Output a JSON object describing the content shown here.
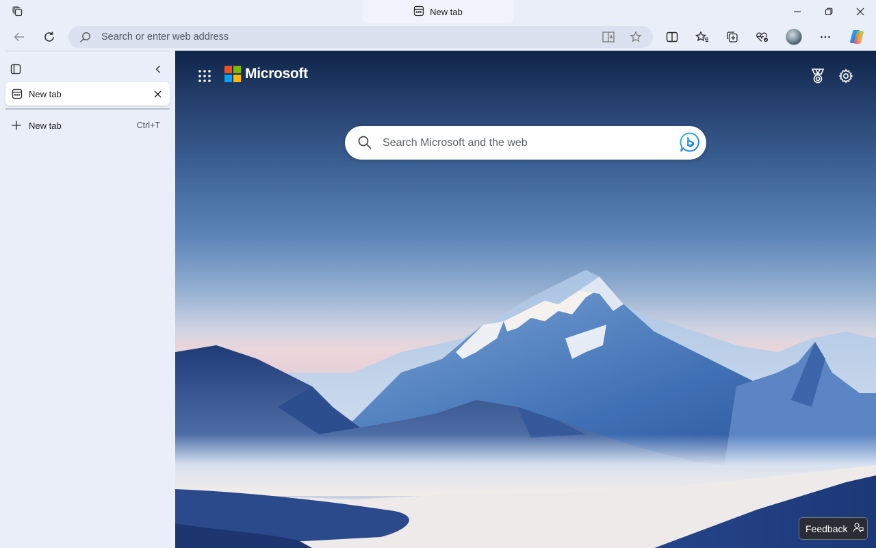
{
  "titlebar": {
    "tab_title": "New tab",
    "workspaces_icon": "workspaces-icon",
    "minimize_icon": "minimize-icon",
    "restore_icon": "restore-icon",
    "close_icon": "close-icon"
  },
  "toolbar": {
    "back_icon": "back-arrow-icon",
    "refresh_icon": "refresh-icon",
    "address_placeholder": "Search or enter web address",
    "address_value": "",
    "immersive_reader_icon": "immersive-reader-icon",
    "favorite_icon": "star-icon",
    "split_screen_icon": "split-screen-icon",
    "favorites_icon": "favorites-icon",
    "collections_icon": "collections-icon",
    "browser_essentials_icon": "heart-pulse-icon",
    "profile_icon": "avatar",
    "more_icon": "more-icon",
    "copilot_icon": "copilot-icon"
  },
  "sidebar": {
    "tab_actions_icon": "tab-actions-icon",
    "collapse_icon": "chevron-left-icon",
    "tabs": [
      {
        "label": "New tab",
        "active": true
      }
    ],
    "new_tab_label": "New tab",
    "new_tab_shortcut": "Ctrl+T"
  },
  "newtab_page": {
    "brand": "Microsoft",
    "brand_colors": [
      "#f25022",
      "#7fba00",
      "#00a4ef",
      "#ffb900"
    ],
    "search_placeholder": "Search Microsoft and the web",
    "search_value": "",
    "apps_icon": "app-launcher-icon",
    "rewards_icon": "trophy-icon",
    "settings_icon": "gear-icon",
    "bing_icon": "bing-chat-icon",
    "feedback_label": "Feedback",
    "feedback_icon": "feedback-icon"
  },
  "colors": {
    "chrome_bg": "#e9eef9",
    "address_bg": "#dbe1ee",
    "active_tab_bg": "#ffffff"
  }
}
